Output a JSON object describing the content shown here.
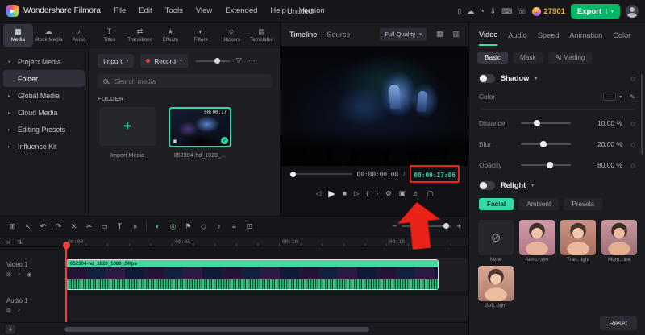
{
  "colors": {
    "accent": "#34d9a6",
    "export_green": "#00b865",
    "annotation_red": "#e8231c",
    "coin_gold": "#f0b73e"
  },
  "menubar": {
    "brand": "Wondershare Filmora",
    "menus": [
      "File",
      "Edit",
      "Tools",
      "View",
      "Extended",
      "Help",
      "Version"
    ],
    "project_title": "Untitled",
    "coin_count": "27901",
    "export_label": "Export"
  },
  "icons": {
    "logo_play": "▶",
    "caret_down": "▾",
    "filter": "▽",
    "more": "⋯",
    "grid_view": "▦",
    "dual_view": "▥",
    "plus": "+",
    "check": "✓",
    "camera": "▣",
    "prev_frame": "◁",
    "play": "▶",
    "stop": "■",
    "next_frame": "▷",
    "mark_in": "{",
    "mark_out": "}",
    "settings": "⚙",
    "snapshot": "▣",
    "volume": "♬",
    "expand": "▢",
    "keyframe": "◇",
    "eyedropper": "✎",
    "none_preset": "⊘",
    "link": "∞",
    "track_scroll": "⇅",
    "lock": "⊠",
    "mute": "♪",
    "eye": "◉",
    "zoom_out": "−",
    "zoom_in": "+",
    "menubar_right": [
      "▯",
      "☁",
      "◔",
      "⇩",
      "⌨",
      "☏"
    ],
    "toolbar": [
      "⊞",
      "↖",
      "↶",
      "↷",
      "✕",
      "✂",
      "▭",
      "T",
      "»",
      "◐",
      "◎",
      "⚑",
      "◇",
      "♪",
      "≡",
      "⊡"
    ]
  },
  "media_tabs": [
    {
      "label": "Media",
      "icon": "▦"
    },
    {
      "label": "Stock Media",
      "icon": "☁"
    },
    {
      "label": "Audio",
      "icon": "♪"
    },
    {
      "label": "Titles",
      "icon": "T"
    },
    {
      "label": "Transitions",
      "icon": "⇄"
    },
    {
      "label": "Effects",
      "icon": "★"
    },
    {
      "label": "Filters",
      "icon": "◐"
    },
    {
      "label": "Stickers",
      "icon": "☺"
    },
    {
      "label": "Templates",
      "icon": "▤"
    }
  ],
  "sidebar": {
    "items": [
      {
        "label": "Project Media",
        "chevron": "▾"
      },
      {
        "label": "Folder",
        "chevron": ""
      },
      {
        "label": "Global Media",
        "chevron": "▸"
      },
      {
        "label": "Cloud Media",
        "chevron": "▸"
      },
      {
        "label": "Editing Presets",
        "chevron": "▸"
      },
      {
        "label": "Influence Kit",
        "chevron": "▸"
      }
    ]
  },
  "library": {
    "import_button": "Import",
    "record_button": "Record",
    "search_placeholder": "Search media",
    "section_label": "FOLDER",
    "import_tile_label": "Import Media",
    "clip_name": "852304-hd_1920_...",
    "clip_duration": "00:00:17"
  },
  "preview": {
    "tabs": [
      "Timeline",
      "Source"
    ],
    "quality_label": "Full Quality",
    "current_time": "00:00:00:00",
    "separator": "/",
    "duration": "00:00:17:06"
  },
  "properties": {
    "tabs": [
      "Video",
      "Audio",
      "Speed",
      "Animation",
      "Color"
    ],
    "subtabs": [
      "Basic",
      "Mask",
      "AI Matting"
    ],
    "shadow_label": "Shadow",
    "color_label": "Color",
    "sliders": [
      {
        "label": "Distance",
        "value": "10.00 %",
        "knob": "32%"
      },
      {
        "label": "Blur",
        "value": "20.00 %",
        "knob": "45%"
      },
      {
        "label": "Opacity",
        "value": "80.00 %",
        "knob": "58%"
      }
    ],
    "relight_label": "Relight",
    "relight_modes": [
      "Facial",
      "Ambient",
      "Presets"
    ],
    "presets": [
      {
        "label": "None"
      },
      {
        "label": "Atmo...ere"
      },
      {
        "label": "Tran...ight"
      },
      {
        "label": "Morn...ine"
      },
      {
        "label": "Soft...ight"
      }
    ],
    "reset_label": "Reset"
  },
  "timeline": {
    "ruler_labels": [
      "00:00",
      "00:05",
      "00:10",
      "00:15"
    ],
    "clip_label": "852304-hd_1920_1080_24fps",
    "tracks": [
      {
        "name": "Video 1"
      },
      {
        "name": "Audio 1"
      }
    ],
    "zoom_knob": "88%"
  }
}
